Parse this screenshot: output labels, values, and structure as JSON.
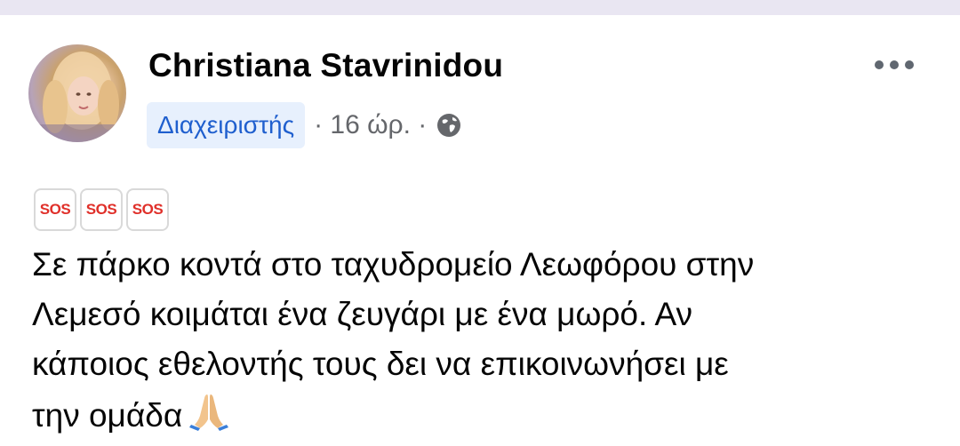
{
  "post": {
    "author_name": "Christiana Stavrinidou",
    "role_badge": "Διαχειριστής",
    "meta_time": "· 16 ώρ. ·",
    "audience_icon": "globe-icon",
    "more_icon": "more-options-icon",
    "sos_badges": [
      "SOS",
      "SOS",
      "SOS"
    ],
    "text_lines": [
      "Σε πάρκο κοντά στο ταχυδρομείο Λεωφόρου στην",
      "Λεμεσό κοιμάται ένα ζευγάρι με ένα μωρό. Αν",
      "κάποιος εθελοντής τους δει να επικοινωνήσει με",
      "την ομάδα"
    ],
    "end_emoji": "folded-hands-icon"
  },
  "colors": {
    "badge_bg": "#e7f0fd",
    "badge_text": "#1f5fce",
    "meta_text": "#65676b",
    "sos_red": "#e0302a",
    "top_strip": "#e9e6f2"
  }
}
